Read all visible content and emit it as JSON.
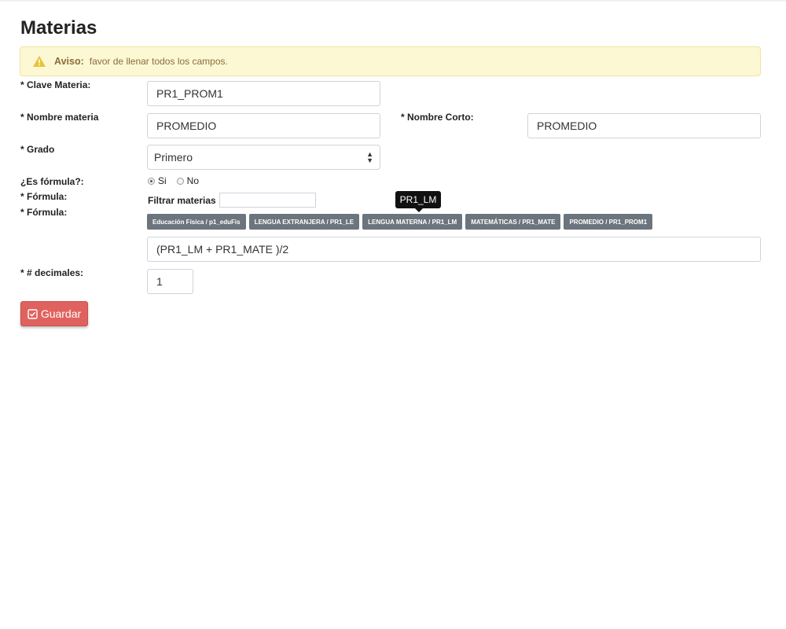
{
  "title": "Materias",
  "alert": {
    "label": "Aviso:",
    "message": "favor de llenar todos los campos.",
    "icon": "warning-icon"
  },
  "form": {
    "clave": {
      "label": "* Clave Materia:",
      "value": "PR1_PROM1"
    },
    "nombre": {
      "label": "* Nombre materia",
      "value": "PROMEDIO"
    },
    "nombre_corto": {
      "label": "* Nombre Corto:",
      "value": "PROMEDIO"
    },
    "grado": {
      "label": "* Grado",
      "value": "Primero"
    },
    "es_formula": {
      "label": "¿Es fórmula?:",
      "options": [
        "Si",
        "No"
      ],
      "selected": "Si"
    },
    "formula_label_1": "* Fórmula:",
    "formula_label_2": "* Fórmula:",
    "filtrar_label": "Filtrar materias :",
    "filtrar_value": "",
    "tooltip": "PR1_LM",
    "chips": [
      "Educación Física / p1_eduFis",
      "LENGUA EXTRANJERA / PR1_LE",
      "LENGUA MATERNA / PR1_LM",
      "MATEMÁTICAS / PR1_MATE",
      "PROMEDIO / PR1_PROM1"
    ],
    "formula_value": "(PR1_LM + PR1_MATE )/2",
    "decimales": {
      "label": "* # decimales:",
      "value": "1"
    }
  },
  "save_button": {
    "label": "Guardar",
    "icon": "checkbox-icon"
  },
  "colors": {
    "alert_bg": "#fcf8d4",
    "alert_text": "#8a6d3b",
    "chip_bg": "#6c757d",
    "save_bg": "#e0625e"
  }
}
